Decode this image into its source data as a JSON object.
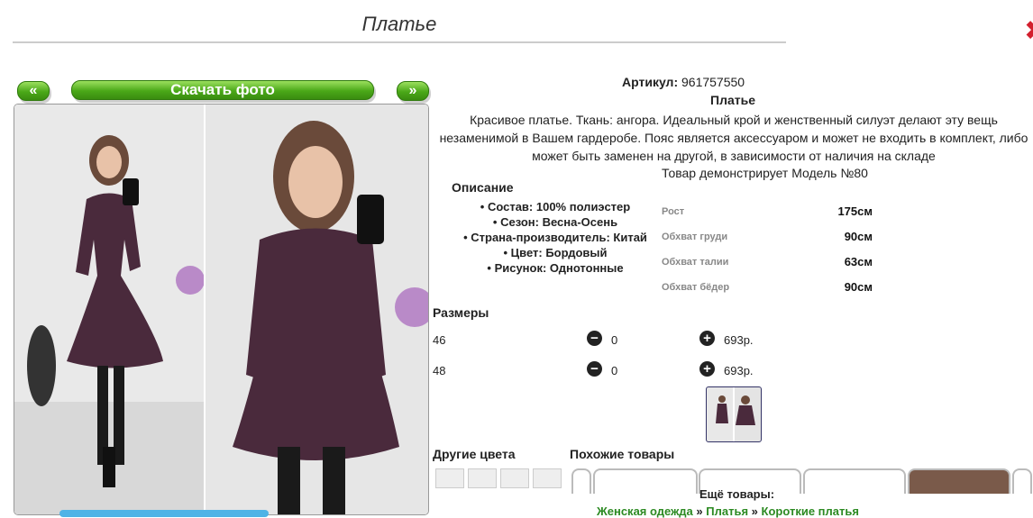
{
  "title": "Платье",
  "nav": {
    "prev_label": "«",
    "download_label": "Скачать фото",
    "next_label": "»"
  },
  "product": {
    "article_label": "Артикул:",
    "article_value": "961757550",
    "name": "Платье",
    "description": "Красивое платье. Ткань: ангора. Идеальный крой и женственный силуэт делают эту вещь незаменимой в Вашем гардеробе. Пояс является аксессуаром и может не входить в комплект, либо может быть заменен на другой, в зависимости от наличия на складе",
    "model_note": "Товар демонстрирует Модель №80"
  },
  "features": {
    "heading": "Описание",
    "items": [
      "Состав: 100% полиэстер",
      "Сезон: Весна-Осень",
      "Страна-производитель: Китай",
      "Цвет: Бордовый",
      "Рисунок: Однотонные"
    ]
  },
  "measurements": [
    {
      "label": "Рост",
      "value": "175см"
    },
    {
      "label": "Обхват груди",
      "value": "90см"
    },
    {
      "label": "Обхват талии",
      "value": "63см"
    },
    {
      "label": "Обхват бёдер",
      "value": "90см"
    }
  ],
  "sizes": {
    "heading": "Размеры",
    "rows": [
      {
        "size": "46",
        "qty": "0",
        "price": "693р."
      },
      {
        "size": "48",
        "qty": "0",
        "price": "693р."
      }
    ]
  },
  "other_colors_heading": "Другие цвета",
  "similar_heading": "Похожие товары",
  "more": {
    "label": "Ещё товары:",
    "crumbs": [
      "Женская одежда",
      "Платья",
      "Короткие платья"
    ],
    "separator": "»"
  },
  "colors": {
    "accent_green": "#4aa818",
    "close_red": "#d3202e",
    "link_green": "#2c8a22"
  }
}
